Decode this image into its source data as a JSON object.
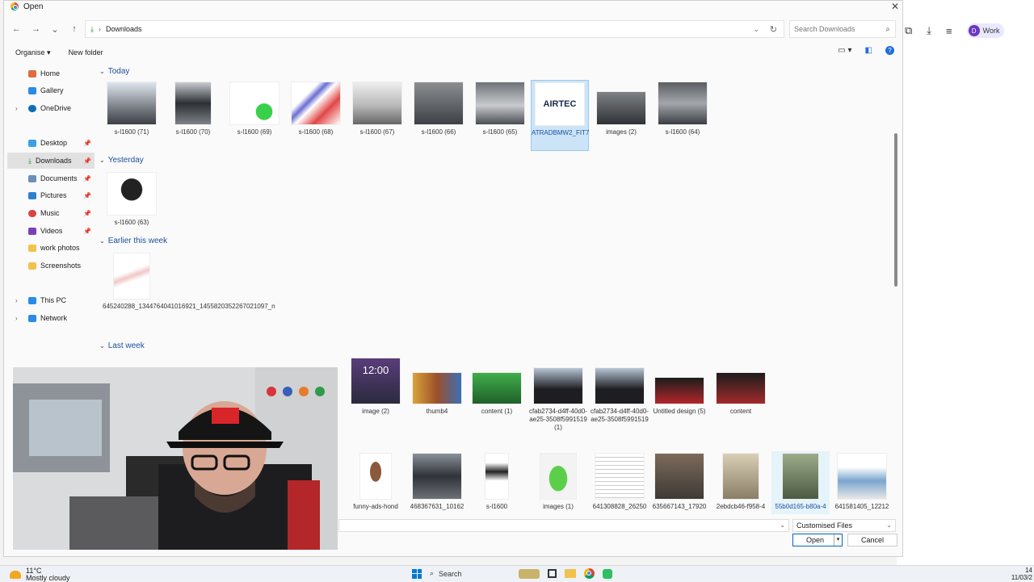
{
  "dialog": {
    "title": "Open",
    "address": "Downloads",
    "search_placeholder": "Search Downloads",
    "organise": "Organise",
    "new_folder": "New folder",
    "file_type": "Customised Files",
    "open_label": "Open",
    "cancel_label": "Cancel"
  },
  "sidebar": {
    "home": "Home",
    "gallery": "Gallery",
    "onedrive": "OneDrive",
    "desktop": "Desktop",
    "downloads": "Downloads",
    "documents": "Documents",
    "pictures": "Pictures",
    "music": "Music",
    "videos": "Videos",
    "work_photos": "work photos",
    "screenshots": "Screenshots",
    "this_pc": "This PC",
    "network": "Network"
  },
  "groups": {
    "today": "Today",
    "yesterday": "Yesterday",
    "earlier": "Earlier this week",
    "lastweek": "Last week"
  },
  "files": {
    "t1": "s-l1600 (71)",
    "t2": "s-l1600 (70)",
    "t3": "s-l1600 (69)",
    "t4": "s-l1600 (68)",
    "t5": "s-l1600 (67)",
    "t6": "s-l1600 (66)",
    "t7": "s-l1600 (65)",
    "t8": "ATRADBMW2_FIT7",
    "t9": "images (2)",
    "t10": "s-l1600 (64)",
    "y1": "s-l1600 (63)",
    "e1": "645240288_1344764041016921_1455820352267021097_n",
    "l1": "image (2)",
    "l2": "thumb4",
    "l3": "content (1)",
    "l4": "cfab2734-d4ff-40d0-ae25-3508f5991519 (1)",
    "l5": "cfab2734-d4ff-40d0-ae25-3508f5991519",
    "l6": "Untitled design (5)",
    "l7": "content",
    "m1": "funny-ads-hond",
    "m2": "468367631_10162",
    "m3": "s-l1600",
    "m4": "images (1)",
    "m5": "641308828_26250",
    "m6": "635667143_17920",
    "m7": "2ebdcb46-f958-4",
    "m8": "55b0d165-b80a-4",
    "m9": "641581405_12212"
  },
  "thumb_text": {
    "airtec": "AIRTEC",
    "clock": "12:00"
  },
  "browser": {
    "profile_initial": "D",
    "profile_label": "Work"
  },
  "taskbar": {
    "temp": "11°C",
    "weather": "Mostly cloudy",
    "search": "Search",
    "time": "14",
    "date": "11/03/2"
  }
}
